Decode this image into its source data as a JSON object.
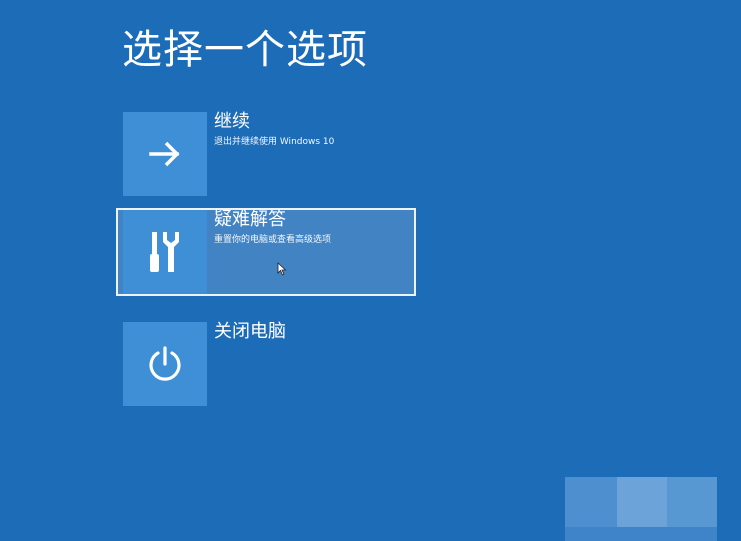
{
  "screen": {
    "title": "选择一个选项",
    "background": "#1d6cb8",
    "tile_color": "#3e8fd6"
  },
  "options": [
    {
      "label": "继续",
      "description": "退出并继续使用 Windows 10",
      "icon": "arrow-right-icon",
      "selected": false
    },
    {
      "label": "疑难解答",
      "description": "重置你的电脑或查看高级选项",
      "icon": "tools-icon",
      "selected": true
    },
    {
      "label": "关闭电脑",
      "description": "",
      "icon": "power-icon",
      "selected": false
    }
  ]
}
